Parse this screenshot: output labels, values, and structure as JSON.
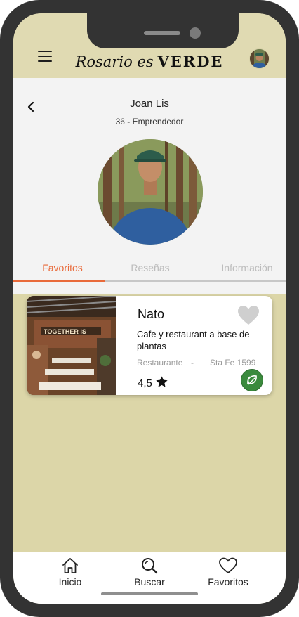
{
  "app": {
    "brand_script": "Rosario es",
    "brand_bold": "VERDE"
  },
  "profile": {
    "name": "Joan Lis",
    "subtitle": "36 - Emprendedor"
  },
  "tabs": [
    {
      "label": "Favoritos",
      "active": true
    },
    {
      "label": "Reseñas",
      "active": false
    },
    {
      "label": "Información",
      "active": false
    }
  ],
  "favorites": [
    {
      "title": "Nato",
      "description": "Cafe y restaurant a base de plantas",
      "category": "Restaurante",
      "separator": "-",
      "address": "Sta Fe 1599",
      "rating": "4,5",
      "image_sign": "TOGETHER IS"
    }
  ],
  "bottom_nav": [
    {
      "label": "Inicio",
      "icon": "home-icon"
    },
    {
      "label": "Buscar",
      "icon": "search-icon"
    },
    {
      "label": "Favoritos",
      "icon": "heart-icon"
    }
  ],
  "colors": {
    "accent": "#e96a3a",
    "background": "#dcd6a8",
    "vegan_badge": "#3a8a3d"
  }
}
